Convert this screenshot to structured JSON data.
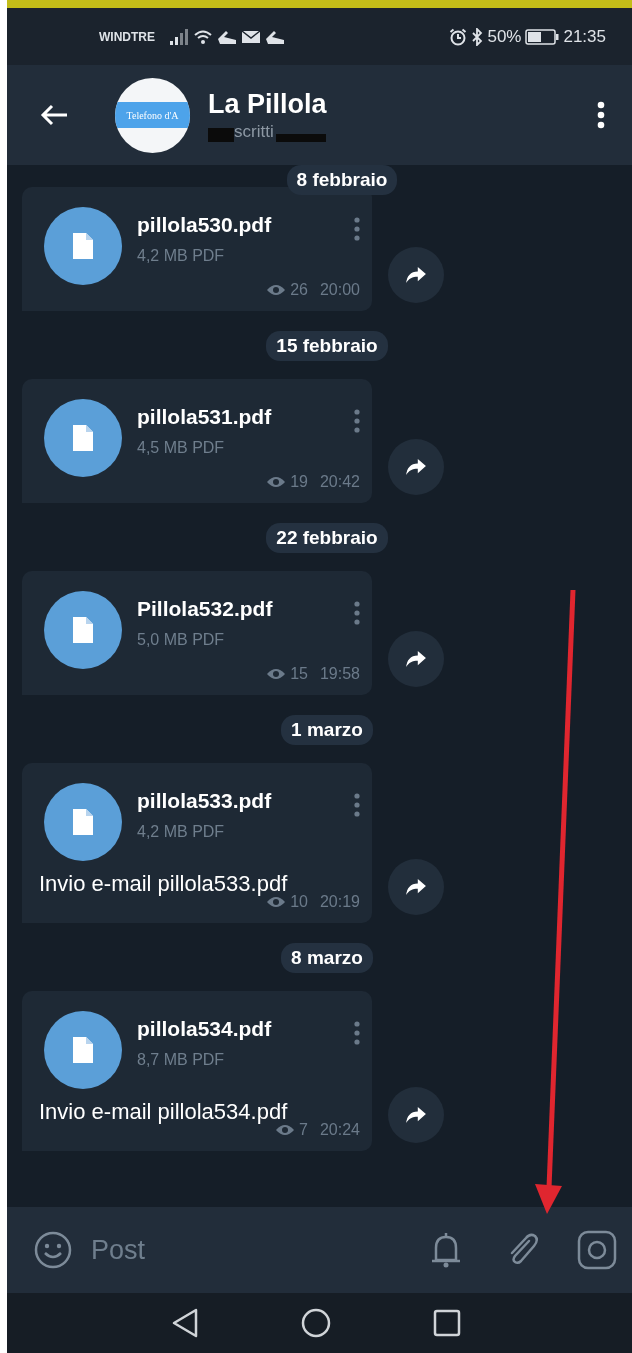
{
  "status_bar": {
    "carrier": "WINDTRE",
    "battery": "50%",
    "time": "21:35"
  },
  "header": {
    "avatar_text": "Telefono d'A",
    "title": "La Pillola",
    "subtitle": "scritti"
  },
  "messages": [
    {
      "date": "8 febbraio",
      "file_name": "pillola530.pdf",
      "file_size": "4,2 MB PDF",
      "views": "26",
      "time": "20:00"
    },
    {
      "date": "15 febbraio",
      "file_name": "pillola531.pdf",
      "file_size": "4,5 MB PDF",
      "views": "19",
      "time": "20:42"
    },
    {
      "date": "22 febbraio",
      "file_name": "Pillola532.pdf",
      "file_size": "5,0 MB PDF",
      "views": "15",
      "time": "19:58"
    },
    {
      "date": "1 marzo",
      "file_name": "pillola533.pdf",
      "file_size": "4,2 MB PDF",
      "caption": "Invio e-mail pillola533.pdf",
      "views": "10",
      "time": "20:19"
    },
    {
      "date": "8 marzo",
      "file_name": "pillola534.pdf",
      "file_size": "8,7 MB PDF",
      "caption": "Invio e-mail pillola534.pdf",
      "views": "7",
      "time": "20:24"
    }
  ],
  "composer": {
    "placeholder": "Post"
  }
}
